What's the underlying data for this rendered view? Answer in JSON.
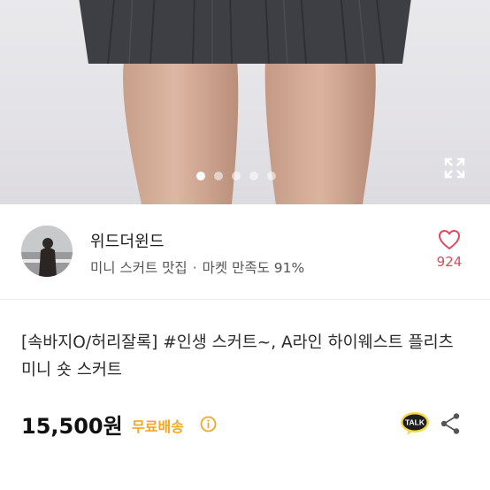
{
  "gallery": {
    "slide_count": 5,
    "active_slide": 1,
    "expand_icon": "expand-icon"
  },
  "seller": {
    "name": "위드더윈드",
    "tagline": "미니 스커트 맛집",
    "separator": "·",
    "satisfaction": "마켓 만족도 91%",
    "like_count": "924",
    "like_icon": "heart-icon",
    "colors": {
      "like": "#e1485f"
    }
  },
  "product": {
    "title": "[속바지O/허리잘록] #인생 스커트~, A라인 하이웨스트 플리츠 미니 숏 스커트",
    "price": "15,500원",
    "shipping": "무료배송",
    "talk_label": "TALK",
    "share_icon": "share-icon",
    "colors": {
      "shipping": "#f5a623",
      "talk_bg": "#1e1e1e"
    }
  }
}
